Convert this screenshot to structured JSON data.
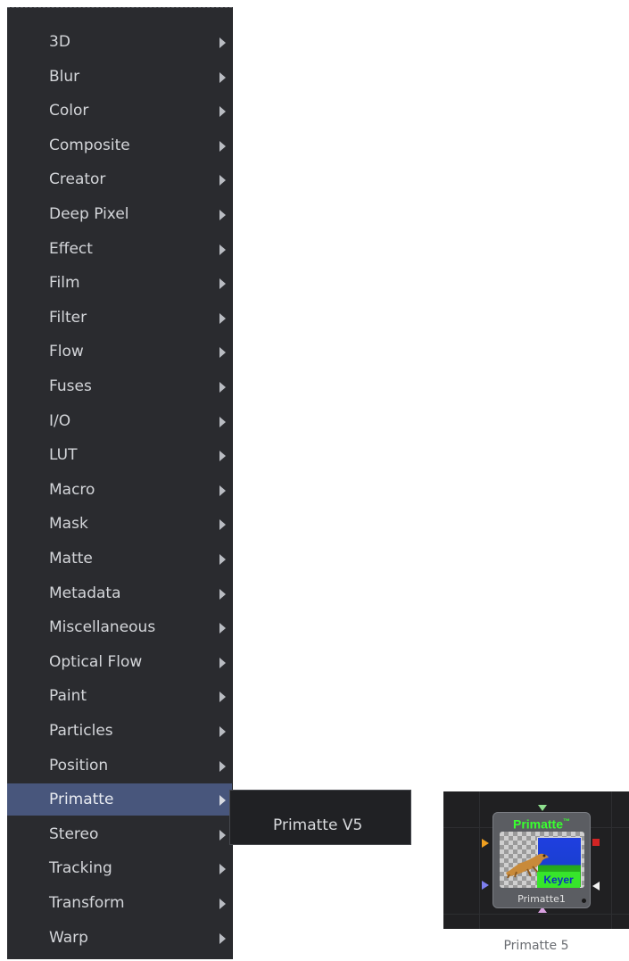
{
  "menu": {
    "items": [
      {
        "label": "3D"
      },
      {
        "label": "Blur"
      },
      {
        "label": "Color"
      },
      {
        "label": "Composite"
      },
      {
        "label": "Creator"
      },
      {
        "label": "Deep Pixel"
      },
      {
        "label": "Effect"
      },
      {
        "label": "Film"
      },
      {
        "label": "Filter"
      },
      {
        "label": "Flow"
      },
      {
        "label": "Fuses"
      },
      {
        "label": "I/O"
      },
      {
        "label": "LUT"
      },
      {
        "label": "Macro"
      },
      {
        "label": "Mask"
      },
      {
        "label": "Matte"
      },
      {
        "label": "Metadata"
      },
      {
        "label": "Miscellaneous"
      },
      {
        "label": "Optical Flow"
      },
      {
        "label": "Paint"
      },
      {
        "label": "Particles"
      },
      {
        "label": "Position"
      },
      {
        "label": "Primatte",
        "selected": true
      },
      {
        "label": "Stereo"
      },
      {
        "label": "Tracking"
      },
      {
        "label": "Transform"
      },
      {
        "label": "Warp"
      }
    ],
    "arrow_icon": "chevron-right-icon"
  },
  "submenu": {
    "items": [
      {
        "label": "Primatte V5"
      }
    ]
  },
  "node": {
    "title": "Primatte",
    "trademark": "™",
    "badge": "Keyer",
    "name": "Primatte1",
    "colors": {
      "title": "#39ff2f",
      "badge_bg": "#37e52b",
      "badge_text": "#0b2fbf",
      "input_orange": "#f0a020",
      "input_blue": "#7d7ff0",
      "input_green": "#8fe08f",
      "input_pink": "#d9a0e0",
      "output_red": "#d22424",
      "output_white": "#f2f2f2"
    }
  },
  "caption": "Primatte 5"
}
